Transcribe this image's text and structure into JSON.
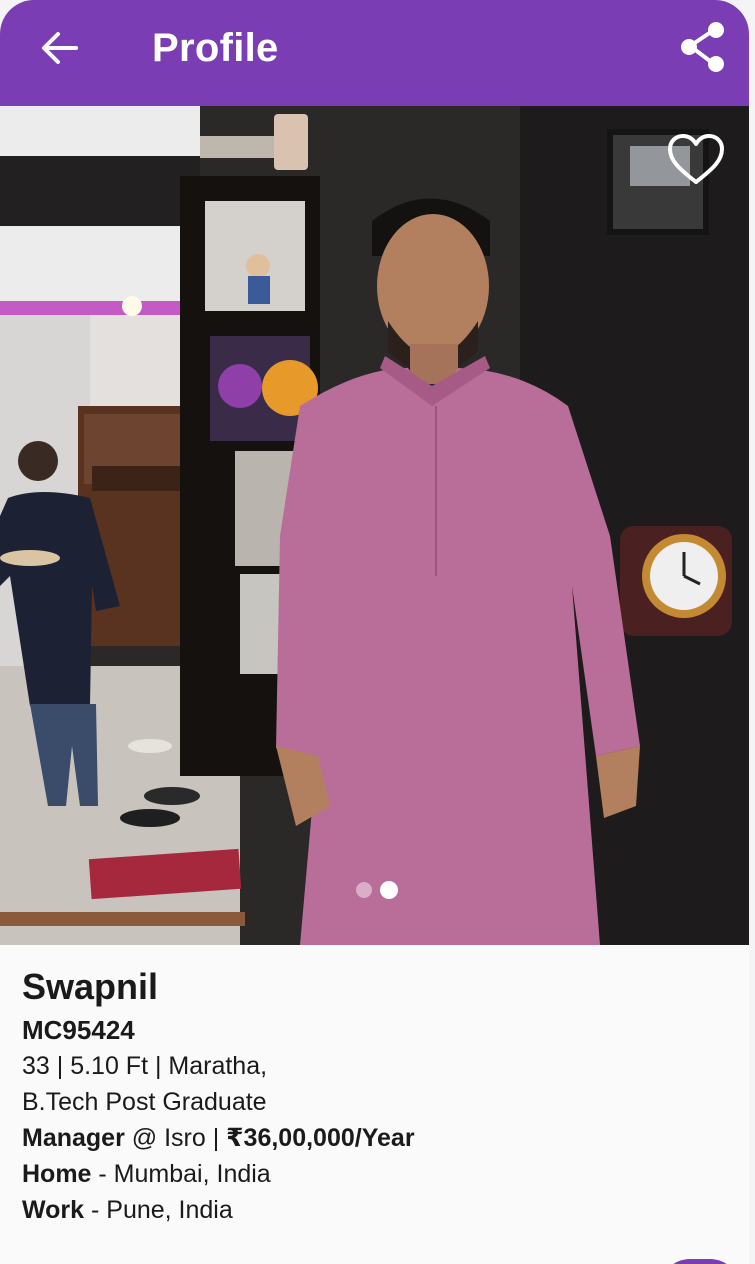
{
  "header": {
    "title": "Profile",
    "back_icon": "arrow-left-icon",
    "share_icon": "share-icon",
    "background_color": "#7a3db3"
  },
  "photo": {
    "favorite_icon": "heart-outline-icon",
    "slide_count": 2,
    "active_slide": 2
  },
  "profile": {
    "name": "Swapnil",
    "profile_id": "MC95424",
    "basics": "33 | 5.10 Ft | Maratha,",
    "education": "B.Tech  Post Graduate",
    "job_title": "Manager",
    "job_at": " @ Isro | ",
    "income": "₹36,00,000/Year",
    "home_label": "Home",
    "home_value": " - Mumbai, India",
    "work_label": "Work",
    "work_value": " - Pune, India"
  }
}
